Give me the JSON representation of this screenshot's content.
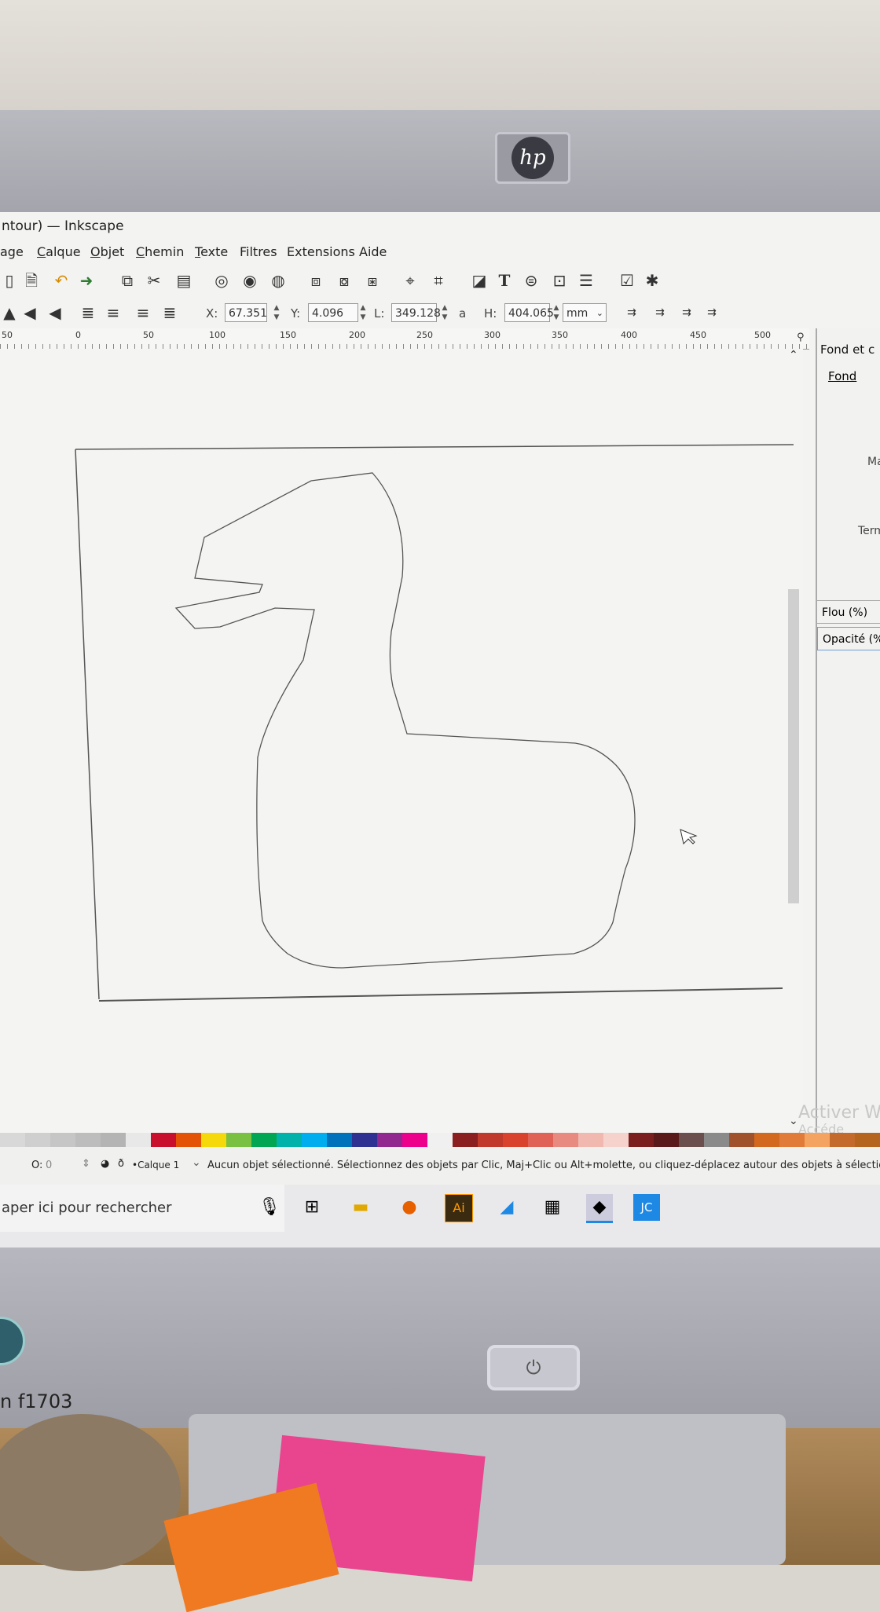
{
  "window": {
    "title": "ntour) — Inkscape"
  },
  "menu": [
    "age",
    "Calque",
    "Objet",
    "Chemin",
    "Texte",
    "Filtres",
    "Extensions",
    "Aide"
  ],
  "selection_toolbar": {
    "x_label": "X:",
    "x_value": "67.351",
    "y_label": "Y:",
    "y_value": "4.096",
    "w_label": "L:",
    "w_value": "349.128",
    "lock_glyph": "a",
    "h_label": "H:",
    "h_value": "404.065",
    "unit": "mm"
  },
  "ruler_ticks": [
    "50",
    "0",
    "50",
    "100",
    "150",
    "200",
    "250",
    "300",
    "350",
    "400",
    "450",
    "500"
  ],
  "panel": {
    "title": "Fond et c",
    "tab": "Fond",
    "label_ma": "Ma",
    "label_term": "Term",
    "blur_label": "Flou (%)",
    "opacity_label": "Opacité (%"
  },
  "palette_colors": [
    "#d8d8d8",
    "#cfcfcf",
    "#c6c6c6",
    "#bdbdbd",
    "#b4b4b4",
    "#e8e8e8",
    "#c8102e",
    "#e35205",
    "#f5d90a",
    "#7ac142",
    "#00a651",
    "#00b2a9",
    "#00aeef",
    "#0072bc",
    "#2e3192",
    "#92278f",
    "#ec008c",
    "#f0f0f0",
    "#8b1e1e",
    "#c0392b",
    "#d9432e",
    "#e06155",
    "#e88a80",
    "#f1b8b0",
    "#f6d2cc",
    "#7a1e1e",
    "#5a1a1a",
    "#6b4f4f",
    "#8a8a8a",
    "#a0522d",
    "#d2691e",
    "#e07b39",
    "#f4a460",
    "#c46a2c",
    "#b5651d"
  ],
  "status": {
    "opacity_label": "O:",
    "opacity_value": "0",
    "layer": "•Calque 1",
    "message": "Aucun objet sélectionné. Sélectionnez des objets par Clic, Maj+Clic ou Alt+molette, ou cliquez-déplacez autour des objets à sélection"
  },
  "watermark": {
    "line1": "Activer W",
    "line2": "Accéde"
  },
  "taskbar": {
    "search_placeholder": "aper ici pour rechercher",
    "apps": [
      "microphone-icon",
      "task-view-icon",
      "file-explorer-icon",
      "firefox-icon",
      "illustrator-icon",
      "laptop-icon",
      "calculator-icon",
      "inkscape-icon",
      "jc-app-icon"
    ],
    "illustrator_label": "Ai",
    "jc_label": "JC"
  },
  "monitor": {
    "brand": "hp",
    "model": "n f1703"
  }
}
